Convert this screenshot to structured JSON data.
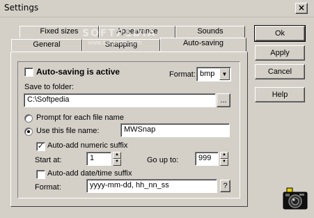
{
  "window": {
    "title": "Settings",
    "close_glyph": "×"
  },
  "watermark": {
    "text": "SOFTPEDIA",
    "sub": "www.softpedia.com"
  },
  "tabs": {
    "row1": [
      {
        "label": "Fixed sizes"
      },
      {
        "label": "Appearance"
      },
      {
        "label": "Sounds"
      }
    ],
    "row2": [
      {
        "label": "General"
      },
      {
        "label": "Snapping"
      },
      {
        "label": "Auto-saving",
        "active": true
      }
    ]
  },
  "auto_saving": {
    "active_label": "Auto-saving is active",
    "active_checked": false,
    "format_label": "Format:",
    "format_value": "bmp",
    "save_folder_label": "Save to folder:",
    "save_folder_value": "C:\\Softpedia",
    "browse_label": "...",
    "prompt_label": "Prompt for each file name",
    "use_name_label": "Use this file name:",
    "file_name_value": "MWSnap",
    "numeric_suffix_label": "Auto-add numeric suffix",
    "numeric_suffix_checked": true,
    "start_at_label": "Start at:",
    "start_at_value": "1",
    "go_up_to_label": "Go up to:",
    "go_up_to_value": "999",
    "datetime_suffix_label": "Auto-add date/time suffix",
    "datetime_suffix_checked": false,
    "datetime_format_label": "Format:",
    "datetime_format_value": "yyyy-mm-dd, hh_nn_ss",
    "datetime_help_label": "?"
  },
  "buttons": {
    "ok": "Ok",
    "apply": "Apply",
    "cancel": "Cancel",
    "help": "Help"
  },
  "icons": {
    "camera": "camera-icon"
  }
}
